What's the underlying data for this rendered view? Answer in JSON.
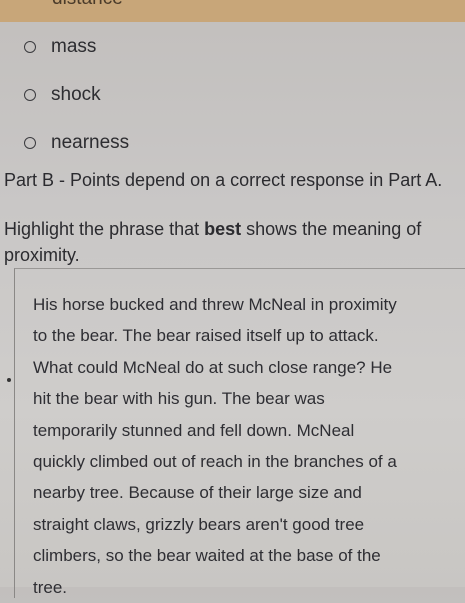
{
  "top_band": {
    "partial_text": "distance"
  },
  "options": [
    {
      "label": "mass"
    },
    {
      "label": "shock"
    },
    {
      "label": "nearness"
    }
  ],
  "part_b": {
    "text": "Part B - Points depend on a correct response in Part A."
  },
  "instruction": {
    "before": "Highlight the phrase that ",
    "emphasis": "best",
    "after": " shows the meaning of proximity."
  },
  "passage": {
    "lines": [
      "His horse bucked and threw McNeal in proximity",
      "to the bear. The bear raised itself up to attack.",
      "What could McNeal do at such close range? He",
      "hit the bear with his gun. The bear was",
      "temporarily stunned and fell down. McNeal",
      "quickly climbed out of reach in the branches of a",
      "nearby tree. Because of their large size and",
      "straight claws, grizzly bears aren't good tree",
      "climbers, so the bear waited at the base of the",
      "tree."
    ]
  }
}
